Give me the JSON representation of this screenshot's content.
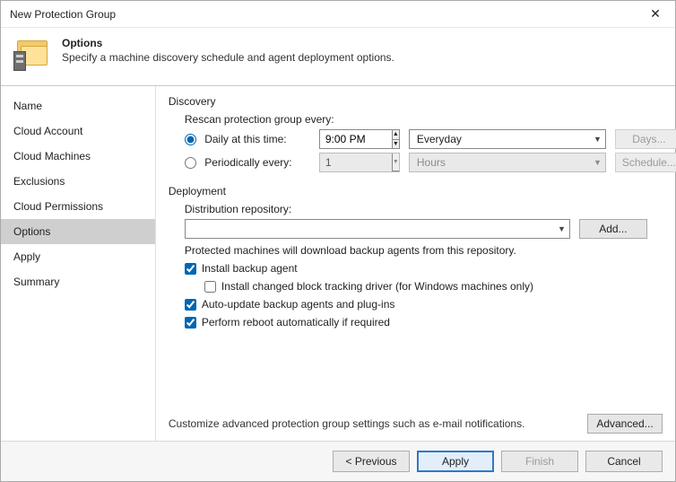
{
  "window": {
    "title": "New Protection Group"
  },
  "header": {
    "title": "Options",
    "subtitle": "Specify a machine discovery schedule and agent deployment options."
  },
  "sidebar": {
    "items": [
      {
        "label": "Name"
      },
      {
        "label": "Cloud Account"
      },
      {
        "label": "Cloud Machines"
      },
      {
        "label": "Exclusions"
      },
      {
        "label": "Cloud Permissions"
      },
      {
        "label": "Options"
      },
      {
        "label": "Apply"
      },
      {
        "label": "Summary"
      }
    ],
    "active_index": 5
  },
  "discovery": {
    "section_label": "Discovery",
    "rescan_label": "Rescan protection group every:",
    "daily": {
      "radio_label": "Daily at this time:",
      "time": "9:00 PM",
      "day_select": "Everyday",
      "days_button": "Days..."
    },
    "periodic": {
      "radio_label": "Periodically every:",
      "value": "1",
      "unit": "Hours",
      "schedule_button": "Schedule..."
    }
  },
  "deployment": {
    "section_label": "Deployment",
    "repo_label": "Distribution repository:",
    "repo_value": "",
    "add_button": "Add...",
    "note": "Protected machines will download backup agents from this repository.",
    "install_agent": "Install backup agent",
    "install_cbt": "Install changed block tracking driver (for Windows machines only)",
    "auto_update": "Auto-update backup agents and plug-ins",
    "auto_reboot": "Perform reboot automatically if required"
  },
  "advanced": {
    "text": "Customize advanced protection group settings such as e-mail notifications.",
    "button": "Advanced..."
  },
  "footer": {
    "previous": "< Previous",
    "apply": "Apply",
    "finish": "Finish",
    "cancel": "Cancel"
  }
}
